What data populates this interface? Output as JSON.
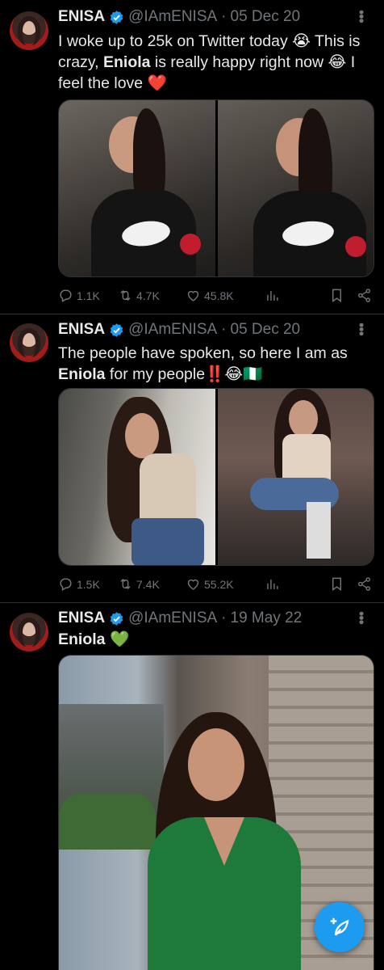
{
  "tweets": [
    {
      "author": "ENISA",
      "handle": "@IAmENISA",
      "separator": "·",
      "date": "05 Dec 20",
      "text_parts": [
        "I woke up to 25k on Twitter today ",
        "😭",
        " This is crazy, ",
        "Eniola",
        " is really happy right now ",
        "😂",
        " I feel the love ",
        "❤️"
      ],
      "stats": {
        "replies": "1.1K",
        "reposts": "4.7K",
        "likes": "45.8K"
      }
    },
    {
      "author": "ENISA",
      "handle": "@IAmENISA",
      "separator": "·",
      "date": "05 Dec 20",
      "text_parts": [
        "The people have spoken, so here I am as ",
        "Eniola",
        " for my people",
        "‼️",
        "😂",
        "🇳🇬"
      ],
      "stats": {
        "replies": "1.5K",
        "reposts": "7.4K",
        "likes": "55.2K"
      }
    },
    {
      "author": "ENISA",
      "handle": "@IAmENISA",
      "separator": "·",
      "date": "19 May 22",
      "text_parts": [
        "Eniola",
        " ",
        "💚"
      ]
    }
  ],
  "colors": {
    "background": "#000000",
    "text": "#e7e9ea",
    "muted": "#71767b",
    "divider": "#2f3336",
    "verified": "#1d9bf0",
    "fab": "#1d9bf0"
  },
  "icons": {
    "verified": "verified-badge-icon",
    "reply": "reply-icon",
    "repost": "repost-icon",
    "like": "heart-icon",
    "views": "views-icon",
    "bookmark": "bookmark-icon",
    "share": "share-icon",
    "compose": "compose-icon"
  }
}
